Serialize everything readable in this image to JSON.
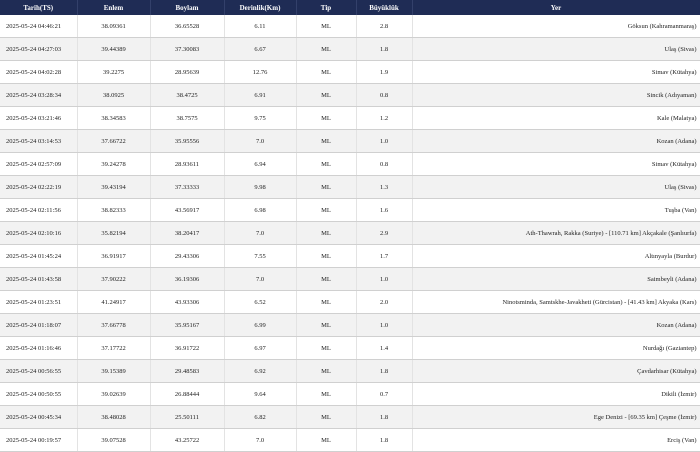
{
  "headers": {
    "tarih": "Tarih(TS)",
    "enlem": "Enlem",
    "boylam": "Boylam",
    "derinlik": "Derinlik(Km)",
    "tip": "Tip",
    "buyukluk": "Büyüklük",
    "yer": "Yer"
  },
  "rows": [
    {
      "tarih": "2025-05-24 04:46:21",
      "enlem": "38.09361",
      "boylam": "36.65528",
      "derinlik": "6.11",
      "tip": "ML",
      "buyukluk": "2.8",
      "yer": "Göksun (Kahramanmaraş)"
    },
    {
      "tarih": "2025-05-24 04:27:03",
      "enlem": "39.44389",
      "boylam": "37.30083",
      "derinlik": "6.67",
      "tip": "ML",
      "buyukluk": "1.8",
      "yer": "Ulaş (Sivas)"
    },
    {
      "tarih": "2025-05-24 04:02:28",
      "enlem": "39.2275",
      "boylam": "28.95639",
      "derinlik": "12.76",
      "tip": "ML",
      "buyukluk": "1.9",
      "yer": "Simav (Kütahya)"
    },
    {
      "tarih": "2025-05-24 03:28:34",
      "enlem": "38.0925",
      "boylam": "38.4725",
      "derinlik": "6.91",
      "tip": "ML",
      "buyukluk": "0.8",
      "yer": "Sincik (Adıyaman)"
    },
    {
      "tarih": "2025-05-24 03:21:46",
      "enlem": "38.34583",
      "boylam": "38.7575",
      "derinlik": "9.75",
      "tip": "ML",
      "buyukluk": "1.2",
      "yer": "Kale (Malatya)"
    },
    {
      "tarih": "2025-05-24 03:14:53",
      "enlem": "37.66722",
      "boylam": "35.95556",
      "derinlik": "7.0",
      "tip": "ML",
      "buyukluk": "1.0",
      "yer": "Kozan (Adana)"
    },
    {
      "tarih": "2025-05-24 02:57:09",
      "enlem": "39.24278",
      "boylam": "28.93611",
      "derinlik": "6.94",
      "tip": "ML",
      "buyukluk": "0.8",
      "yer": "Simav (Kütahya)"
    },
    {
      "tarih": "2025-05-24 02:22:19",
      "enlem": "39.43194",
      "boylam": "37.33333",
      "derinlik": "9.98",
      "tip": "ML",
      "buyukluk": "1.3",
      "yer": "Ulaş (Sivas)"
    },
    {
      "tarih": "2025-05-24 02:11:56",
      "enlem": "38.82333",
      "boylam": "43.56917",
      "derinlik": "6.98",
      "tip": "ML",
      "buyukluk": "1.6",
      "yer": "Tuşba (Van)"
    },
    {
      "tarih": "2025-05-24 02:10:16",
      "enlem": "35.82194",
      "boylam": "38.20417",
      "derinlik": "7.0",
      "tip": "ML",
      "buyukluk": "2.9",
      "yer": "Ath-Thawrah, Rakka (Suriye) - [110.71 km] Akçakale (Şanlıurfa)"
    },
    {
      "tarih": "2025-05-24 01:45:24",
      "enlem": "36.91917",
      "boylam": "29.43306",
      "derinlik": "7.55",
      "tip": "ML",
      "buyukluk": "1.7",
      "yer": "Altınyayla (Burdur)"
    },
    {
      "tarih": "2025-05-24 01:43:58",
      "enlem": "37.90222",
      "boylam": "36.19306",
      "derinlik": "7.0",
      "tip": "ML",
      "buyukluk": "1.0",
      "yer": "Saimbeyli (Adana)"
    },
    {
      "tarih": "2025-05-24 01:23:51",
      "enlem": "41.24917",
      "boylam": "43.93306",
      "derinlik": "6.52",
      "tip": "ML",
      "buyukluk": "2.0",
      "yer": "Ninotsminda, Samtskhe-Javakheti (Gürcistan) - [41.43 km] Akyaka (Kars)"
    },
    {
      "tarih": "2025-05-24 01:18:07",
      "enlem": "37.66778",
      "boylam": "35.95167",
      "derinlik": "6.99",
      "tip": "ML",
      "buyukluk": "1.0",
      "yer": "Kozan (Adana)"
    },
    {
      "tarih": "2025-05-24 01:16:46",
      "enlem": "37.17722",
      "boylam": "36.91722",
      "derinlik": "6.97",
      "tip": "ML",
      "buyukluk": "1.4",
      "yer": "Nurdağı (Gaziantep)"
    },
    {
      "tarih": "2025-05-24 00:56:55",
      "enlem": "39.15389",
      "boylam": "29.48583",
      "derinlik": "6.92",
      "tip": "ML",
      "buyukluk": "1.8",
      "yer": "Çavdarhisar (Kütahya)"
    },
    {
      "tarih": "2025-05-24 00:50:55",
      "enlem": "39.02639",
      "boylam": "26.88444",
      "derinlik": "9.64",
      "tip": "ML",
      "buyukluk": "0.7",
      "yer": "Dikili (İzmir)"
    },
    {
      "tarih": "2025-05-24 00:45:34",
      "enlem": "38.48028",
      "boylam": "25.50111",
      "derinlik": "6.82",
      "tip": "ML",
      "buyukluk": "1.8",
      "yer": "Ege Denizi - [69.35 km] Çeşme (İzmir)"
    },
    {
      "tarih": "2025-05-24 00:19:57",
      "enlem": "39.07528",
      "boylam": "43.25722",
      "derinlik": "7.0",
      "tip": "ML",
      "buyukluk": "1.8",
      "yer": "Erciş (Van)"
    }
  ]
}
